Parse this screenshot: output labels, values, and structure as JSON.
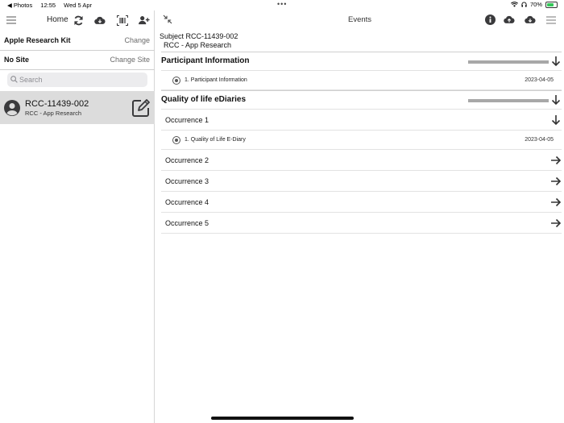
{
  "status_bar": {
    "back_app": "◀ Photos",
    "time": "12:55",
    "date": "Wed 5 Apr",
    "multitask_dots": "•••",
    "battery_text": "70%",
    "battery_level": 0.7,
    "battery_color": "#34c759"
  },
  "left_panel": {
    "nav": {
      "title": "Home",
      "icons": [
        "menu-icon",
        "refresh-icon",
        "cloud-download-icon",
        "barcode-scan-icon",
        "add-user-icon"
      ]
    },
    "research_kit": {
      "name": "Apple Research Kit",
      "change_label": "Change"
    },
    "site": {
      "name": "No Site",
      "change_label": "Change Site"
    },
    "search": {
      "placeholder": "Search",
      "value": ""
    },
    "subjects": [
      {
        "id": "RCC-11439-002",
        "subtitle": "RCC - App Research"
      }
    ]
  },
  "right_panel": {
    "nav": {
      "title": "Events",
      "icons": [
        "collapse-icon",
        "info-icon",
        "cloud-upload-icon",
        "cloud-download-icon",
        "menu-icon"
      ]
    },
    "subject_header": {
      "line1": "Subject RCC-11439-002",
      "line2": "RCC - App Research"
    },
    "sections": [
      {
        "title": "Participant Information",
        "progress": 1.0,
        "expanded": true,
        "forms": [
          {
            "name": "1. Participant Information",
            "date": "2023-04-05"
          }
        ]
      },
      {
        "title": "Quality of life eDiaries",
        "progress": 1.0,
        "expanded": true,
        "occurrences": [
          {
            "label": "Occurrence 1",
            "expanded": true,
            "forms": [
              {
                "name": "1. Quality of Life E-Diary",
                "date": "2023-04-05"
              }
            ]
          },
          {
            "label": "Occurrence 2",
            "expanded": false
          },
          {
            "label": "Occurrence 3",
            "expanded": false
          },
          {
            "label": "Occurrence 4",
            "expanded": false
          },
          {
            "label": "Occurrence 5",
            "expanded": false
          }
        ]
      }
    ]
  },
  "colors": {
    "selected_row": "#dcdcdc",
    "icon": "#3a3a3c",
    "progress_fill": "#a8a8a8"
  }
}
